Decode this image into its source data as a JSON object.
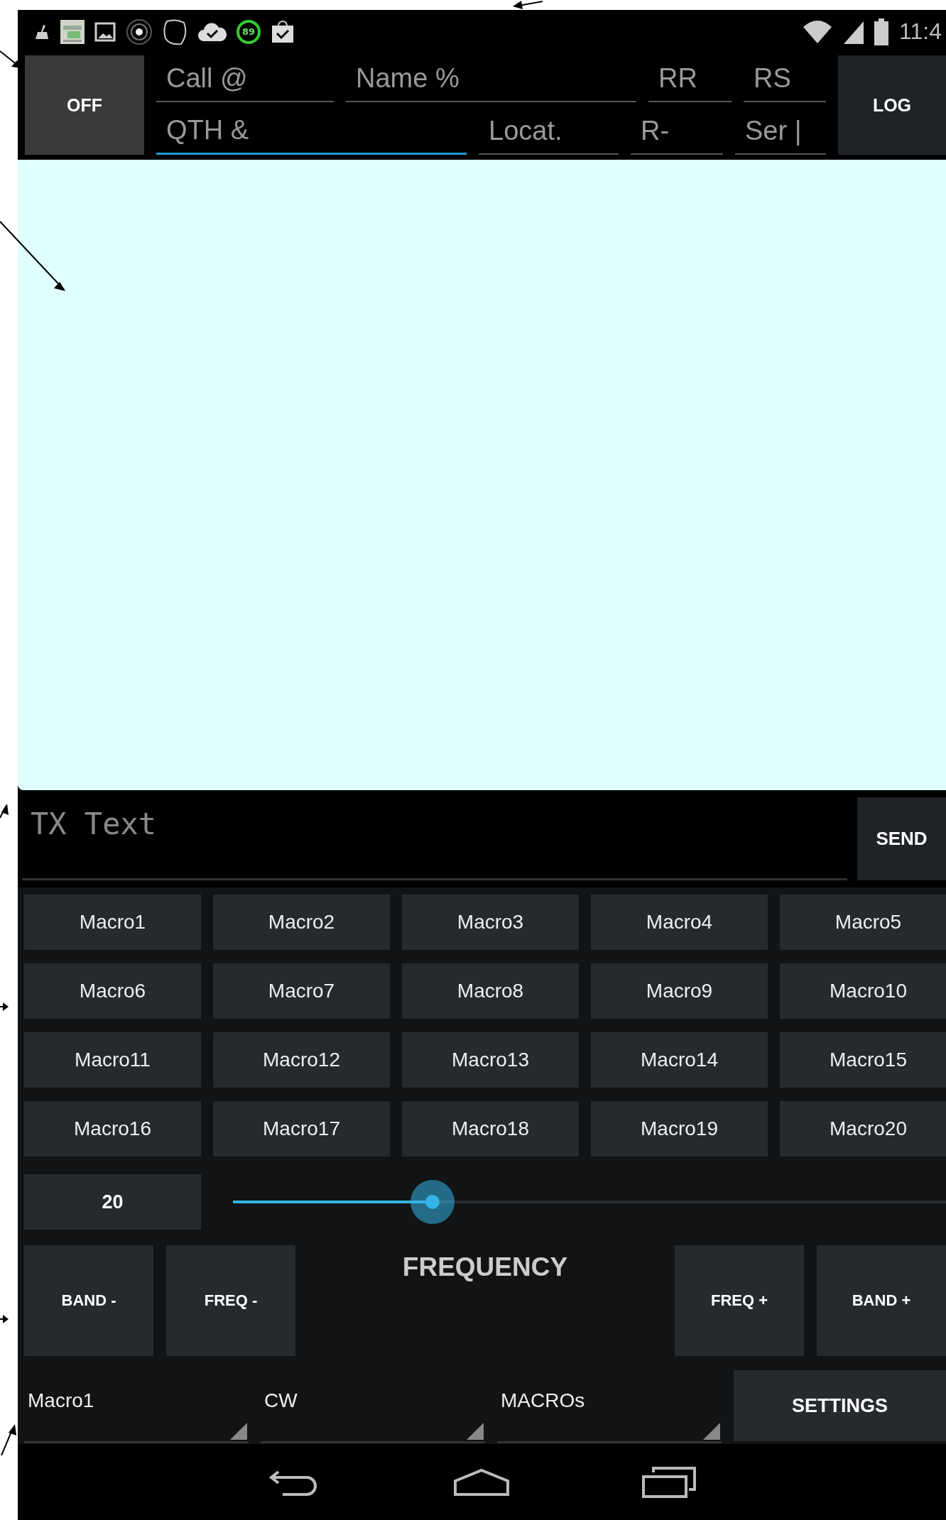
{
  "status_bar": {
    "ring_badge": "89",
    "time": "11:4"
  },
  "top_panel": {
    "power_button": "OFF",
    "log_button": "LOG",
    "fields_row_1": [
      {
        "placeholder": "Call @",
        "focused": false
      },
      {
        "placeholder": "Name %",
        "focused": false
      },
      {
        "placeholder": "RR",
        "focused": false
      },
      {
        "placeholder": "RS",
        "focused": false
      }
    ],
    "fields_row_2": [
      {
        "placeholder": "QTH &",
        "focused": true
      },
      {
        "placeholder": "Locat.",
        "focused": false
      },
      {
        "placeholder": "R-",
        "focused": false
      },
      {
        "placeholder": "Ser |",
        "focused": false
      }
    ]
  },
  "tx": {
    "placeholder": "TX Text",
    "send_button": "SEND"
  },
  "macros": [
    "Macro1",
    "Macro2",
    "Macro3",
    "Macro4",
    "Macro5",
    "Macro6",
    "Macro7",
    "Macro8",
    "Macro9",
    "Macro10",
    "Macro11",
    "Macro12",
    "Macro13",
    "Macro14",
    "Macro15",
    "Macro16",
    "Macro17",
    "Macro18",
    "Macro19",
    "Macro20"
  ],
  "speed": {
    "value": "20",
    "level": 0.28
  },
  "frequency": {
    "title": "FREQUENCY",
    "left_buttons": [
      "BAND -",
      "FREQ -"
    ],
    "right_buttons": [
      "FREQ +",
      "BAND +"
    ]
  },
  "bottom": {
    "spinners": [
      "Macro1",
      "CW",
      "MACROs"
    ],
    "settings_button": "SETTINGS"
  }
}
